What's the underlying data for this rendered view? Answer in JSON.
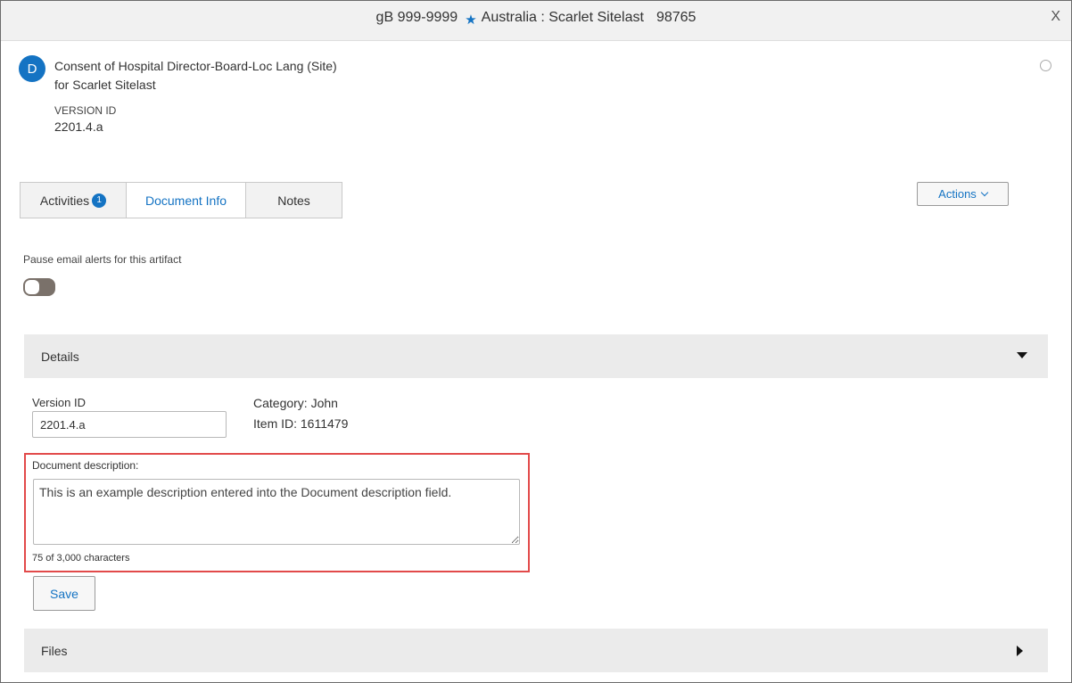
{
  "header": {
    "study_id": "gB 999-9999",
    "site": "Australia : Scarlet Sitelast",
    "site_number": "98765",
    "close_label": "X",
    "star_icon": "star-icon",
    "accent_color": "#1473c3"
  },
  "document": {
    "avatar_letter": "D",
    "title_line1": "Consent of Hospital Director-Board-Loc Lang (Site)",
    "title_line2": "for Scarlet Sitelast",
    "version_label": "VERSION ID",
    "version_value": "2201.4.a"
  },
  "tabs": [
    {
      "label": "Activities",
      "badge": "1",
      "active": false
    },
    {
      "label": "Document Info",
      "active": true
    },
    {
      "label": "Notes",
      "active": false
    }
  ],
  "actions": {
    "label": "Actions"
  },
  "alerts": {
    "pause_label": "Pause email alerts for this artifact",
    "pause_enabled": false
  },
  "details": {
    "section_label": "Details",
    "expanded": true,
    "version_id_label": "Version ID",
    "version_id_value": "2201.4.a",
    "category": "Category: John",
    "item_id": "Item ID: 1611479",
    "description_label": "Document description:",
    "description_value": "This is an example description entered into the Document description field.",
    "char_count": "75 of 3,000 characters",
    "save_label": "Save",
    "highlight_color": "#e24a4a"
  },
  "files": {
    "section_label": "Files",
    "expanded": false
  }
}
